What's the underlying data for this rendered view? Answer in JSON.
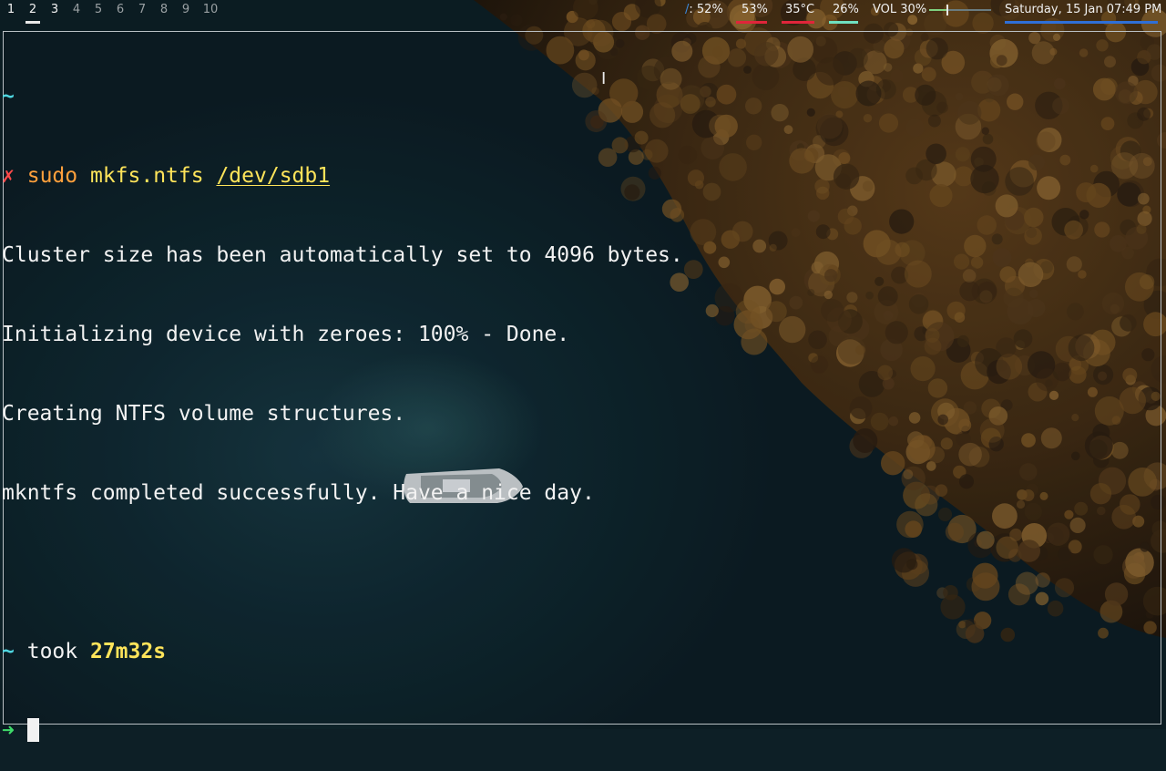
{
  "workspaces": [
    {
      "label": "1",
      "state": "occupied"
    },
    {
      "label": "2",
      "state": "active"
    },
    {
      "label": "3",
      "state": "occupied"
    },
    {
      "label": "4",
      "state": "empty"
    },
    {
      "label": "5",
      "state": "empty"
    },
    {
      "label": "6",
      "state": "empty"
    },
    {
      "label": "7",
      "state": "empty"
    },
    {
      "label": "8",
      "state": "empty"
    },
    {
      "label": "9",
      "state": "empty"
    },
    {
      "label": "10",
      "state": "empty"
    }
  ],
  "status": {
    "disk_prefix": "/",
    "disk_text": ": 52%",
    "cpu_text": "53%",
    "temp_text": "35°C",
    "mem_text": "26%",
    "volume_label": "VOL 30%",
    "volume_level": 0.3,
    "datetime": "Saturday, 15 Jan 07:49 PM",
    "colors": {
      "cpu": "#e0253a",
      "temp": "#e0253a",
      "mem": "#6fe0c0",
      "datetime": "#2f6fd6",
      "disk_icon": "#3d8be0"
    }
  },
  "terminal": {
    "prompt_home": "~",
    "error_mark": "✗",
    "cmd_sudo": "sudo",
    "cmd_name": "mkfs.ntfs",
    "cmd_arg": "/dev/sdb1",
    "output": [
      "Cluster size has been automatically set to 4096 bytes.",
      "Initializing device with zeroes: 100% - Done.",
      "Creating NTFS volume structures.",
      "mkntfs completed successfully. Have a nice day."
    ],
    "took_home": "~",
    "took_label": "took",
    "took_time": "27m32s",
    "prompt_arrow": "➜"
  },
  "wallpaper": {
    "water_color": "#0f2830",
    "forest_color": "#4a3216"
  }
}
